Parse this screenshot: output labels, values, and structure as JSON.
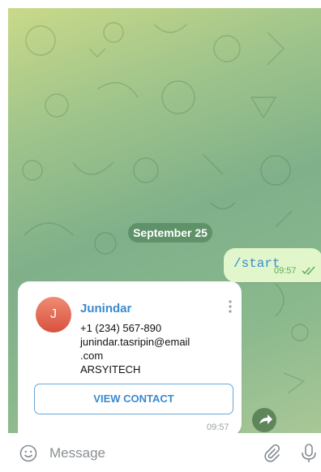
{
  "chat": {
    "date_separator": "September 25",
    "outgoing_message": {
      "text": "/start",
      "time": "09:57",
      "status": "read"
    },
    "contact_card": {
      "avatar_initial": "J",
      "name": "Junindar",
      "phone": "+1 (234) 567-890",
      "email_line1": "junindar.tasripin@email",
      "email_line2": ".com",
      "company": "ARSYITECH",
      "button_label": "VIEW CONTACT",
      "time": "09:57"
    }
  },
  "input_bar": {
    "placeholder": "Message"
  },
  "icons": {
    "emoji": "smiley-icon",
    "attach": "paperclip-icon",
    "mic": "microphone-icon",
    "share": "share-arrow-icon",
    "menu": "more-vertical-icon",
    "read_receipt": "double-check-icon"
  },
  "colors": {
    "accent": "#3a8ad0",
    "outgoing_bubble": "#e1f6cb",
    "avatar": "#e0604a",
    "read_check": "#5fae5a"
  }
}
